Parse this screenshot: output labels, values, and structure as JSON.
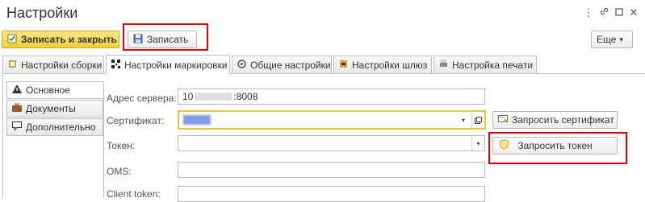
{
  "window": {
    "title": "Настройки",
    "more_icon": "⋮",
    "link_icon": "🔗",
    "minimize_icon": "▫",
    "close_icon": "✕"
  },
  "toolbar": {
    "save_close_label": "Записать и закрыть",
    "save_label": "Записать",
    "more_label": "Еще",
    "more_arrow": "▾"
  },
  "tabs": [
    {
      "label": "Настройки сборки",
      "icon": "settings-icon"
    },
    {
      "label": "Настройки маркировки",
      "icon": "qrcode-icon"
    },
    {
      "label": "Общие настройки",
      "icon": "gear-icon"
    },
    {
      "label": "Настройки шлюз",
      "icon": "gateway-icon"
    },
    {
      "label": "Настройка печати",
      "icon": "print-icon"
    }
  ],
  "side_tabs": [
    {
      "label": "Основное",
      "icon": "warning-icon"
    },
    {
      "label": "Документы",
      "icon": "briefcase-icon"
    },
    {
      "label": "Дополнительно",
      "icon": "chat-icon"
    }
  ],
  "form": {
    "server_label": "Адрес сервера:",
    "server_value_prefix": "10",
    "server_value_suffix": ":8008",
    "cert_label": "Сертификат:",
    "token_label": "Токен:",
    "oms_label": "OMS:",
    "client_token_label": "Client token:"
  },
  "actions": {
    "request_cert_label": "Запросить сертификат",
    "request_token_label": "Запросить токен"
  },
  "colors": {
    "highlight_red": "#e20000",
    "accent_yellow": "#f3d23a",
    "focus_yellow": "#e2c93a"
  }
}
